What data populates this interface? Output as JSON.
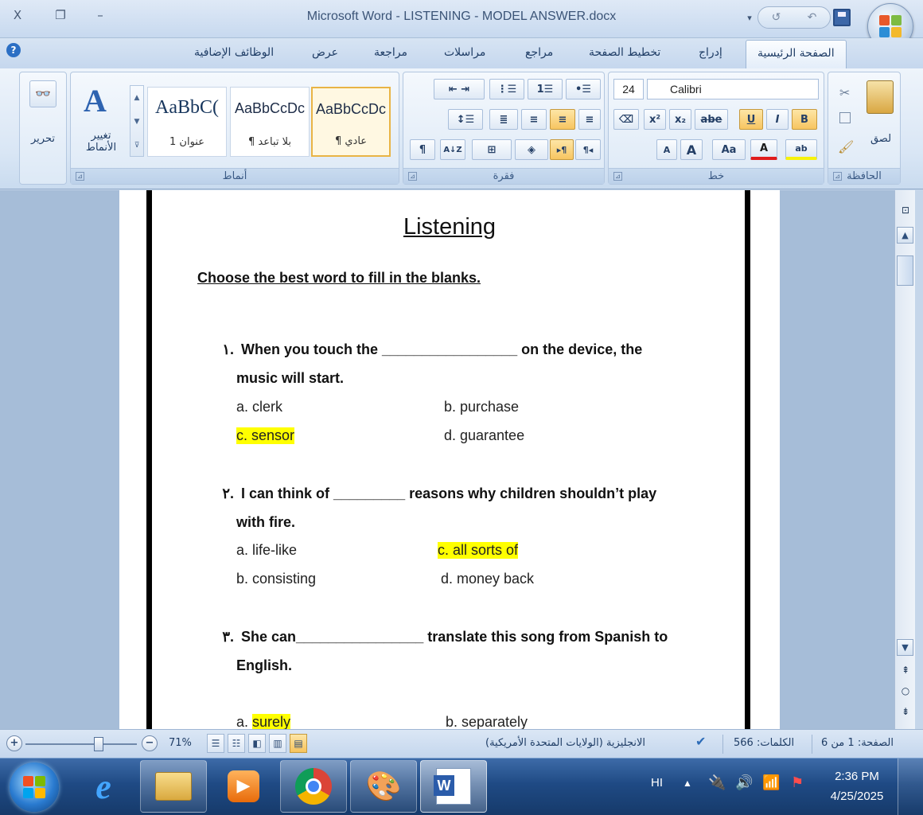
{
  "window": {
    "title": "Microsoft Word - LISTENING - MODEL ANSWER.docx",
    "close_glyph": "X",
    "restore_glyph": "❐",
    "minimize_glyph": "–"
  },
  "qat": {
    "undo_glyph": "↺",
    "redo_glyph": "↶",
    "dropdown_glyph": "▾"
  },
  "tabs": [
    {
      "label": "الصفحة الرئيسية",
      "active": true
    },
    {
      "label": "إدراج"
    },
    {
      "label": "تخطيط الصفحة"
    },
    {
      "label": "مراجع"
    },
    {
      "label": "مراسلات"
    },
    {
      "label": "مراجعة"
    },
    {
      "label": "عرض"
    },
    {
      "label": "الوظائف الإضافية"
    }
  ],
  "ribbon": {
    "clipboard": {
      "group_name": "الحافظة",
      "paste_label": "لصق"
    },
    "font": {
      "group_name": "خط",
      "font_size": "24",
      "font_name": "Calibri",
      "bold": "B",
      "italic": "I",
      "underline": "U",
      "strike": "abe",
      "subscript": "x₂",
      "superscript": "x²",
      "grow": "A",
      "shrink": "A",
      "change_case": "Aa",
      "font_color": "A",
      "highlight": "ab"
    },
    "paragraph": {
      "group_name": "فقرة",
      "pilcrow": "¶",
      "sort": "A↓Z"
    },
    "styles": {
      "group_name": "أنماط",
      "items": [
        {
          "sample": "AaBbCcDc",
          "name": "¶ عادي",
          "selected": true
        },
        {
          "sample": "AaBbCcDc",
          "name": "¶ بلا تباعد"
        },
        {
          "sample": "AaBbC(",
          "name": "عنوان 1"
        }
      ],
      "change_styles_label": "تغيير الأنماط"
    },
    "editing": {
      "label": "تحرير"
    }
  },
  "document": {
    "title": "Listening",
    "instruction": "Choose the best word to fill in the blanks.",
    "questions": [
      {
        "number": "١.",
        "line1": "When you touch the _________________ on the device, the",
        "line2": "music will start.",
        "options": [
          {
            "text": "a.  clerk",
            "highlighted": false
          },
          {
            "text": "b. purchase",
            "highlighted": false
          },
          {
            "text": "c.  sensor",
            "highlighted": true
          },
          {
            "text": "d. guarantee",
            "highlighted": false
          }
        ]
      },
      {
        "number": "٢.",
        "line1": "I can think of _________ reasons why children shouldn’t play",
        "line2": "with fire.",
        "options": [
          {
            "text": "a.  life-like",
            "highlighted": false
          },
          {
            "text": "c. all sorts of",
            "highlighted": true
          },
          {
            "text": "b.  consisting",
            "highlighted": false
          },
          {
            "text": "d. money back",
            "highlighted": false
          }
        ]
      },
      {
        "number": "٣.",
        "line1": "She can________________ translate this song from Spanish to",
        "line2": "English.",
        "options": [
          {
            "text": "a.  ",
            "highlighted": false
          },
          {
            "text": "surely",
            "highlighted": true
          },
          {
            "text": "b. separately",
            "highlighted": false
          }
        ]
      }
    ]
  },
  "statusbar": {
    "page": "الصفحة: 1 من 6",
    "words": "الكلمات: 566",
    "language": "الانجليزية (الولايات المتحدة الأمريكية)",
    "zoom": "71%",
    "zoom_in": "+",
    "zoom_out": "−"
  },
  "taskbar": {
    "lang": "HI",
    "time": "2:36 PM",
    "date": "4/25/2025"
  },
  "colors": {
    "highlight": "#ffff00",
    "ribbon_bg": "#dfe9f5",
    "taskbar_bg": "#1f4a84"
  }
}
